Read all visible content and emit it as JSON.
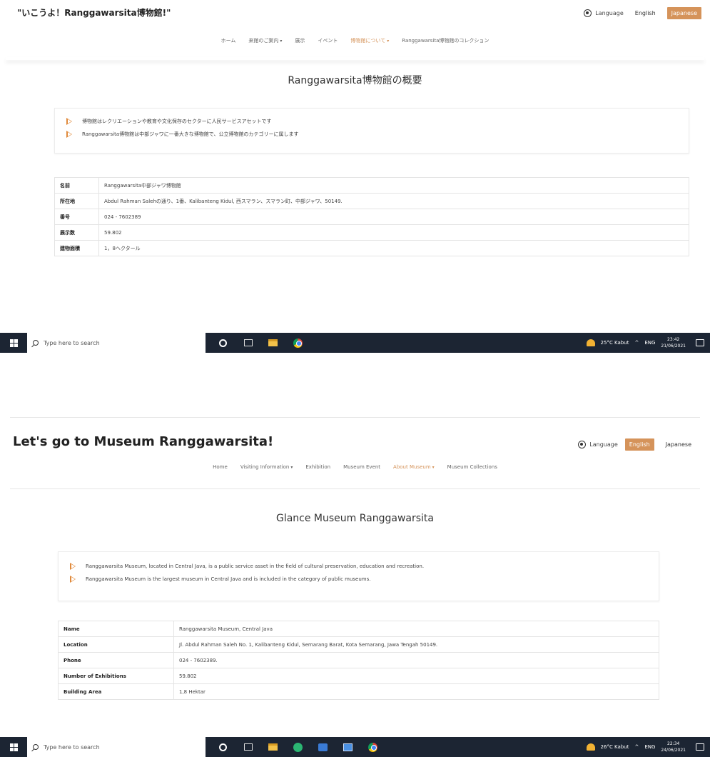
{
  "japanese_view": {
    "site_title": "\"いこうよ！Ranggawarsita博物館!\"",
    "language_label": "Language",
    "languages": {
      "english": "English",
      "japanese": "Japanese"
    },
    "active_language": "Japanese",
    "nav": [
      {
        "label": "ホーム",
        "has_caret": false,
        "active": false
      },
      {
        "label": "来館のご案内",
        "has_caret": true,
        "active": false
      },
      {
        "label": "展示",
        "has_caret": false,
        "active": false
      },
      {
        "label": "イベント",
        "has_caret": false,
        "active": false
      },
      {
        "label": "博物館について",
        "has_caret": true,
        "active": true
      },
      {
        "label": "Ranggawarsita博物館のコレクション",
        "has_caret": false,
        "active": false
      }
    ],
    "heading": "Ranggawarsita博物館の概要",
    "bullets": [
      "博物館はレクリエーションや教育や文化保存のセクターに人民サービスアセットです",
      "Ranggawarsita博物館は中部ジャワに一番大きな博物館で、公立博物館のカテゴリーに属します"
    ],
    "table": [
      {
        "label": "名前",
        "value": "Ranggawarsita中部ジャワ博物館"
      },
      {
        "label": "所在地",
        "value": "Abdul Rahman Salehの通り、1番、Kalibanteng Kidul, 西スマラン、スマラン町、中部ジャワ、50149."
      },
      {
        "label": "番号",
        "value": "024 - 7602389"
      },
      {
        "label": "展示数",
        "value": "59.802"
      },
      {
        "label": "建物面積",
        "value": "1，8ヘクタール"
      }
    ],
    "taskbar": {
      "search_placeholder": "Type here to search",
      "weather": "25°C Kabut",
      "lang": "ENG",
      "time": "23:42",
      "date": "21/06/2021"
    }
  },
  "english_view": {
    "site_title": "Let's go to Museum Ranggawarsita!",
    "language_label": "Language",
    "languages": {
      "english": "English",
      "japanese": "Japanese"
    },
    "active_language": "English",
    "nav": [
      {
        "label": "Home",
        "has_caret": false,
        "active": false
      },
      {
        "label": "Visiting Information",
        "has_caret": true,
        "active": false
      },
      {
        "label": "Exhibition",
        "has_caret": false,
        "active": false
      },
      {
        "label": "Museum Event",
        "has_caret": false,
        "active": false
      },
      {
        "label": "About Museum",
        "has_caret": true,
        "active": true
      },
      {
        "label": "Museum Collections",
        "has_caret": false,
        "active": false
      }
    ],
    "heading": "Glance Museum Ranggawarsita",
    "bullets": [
      "Ranggawarsita Museum, located in Central Java, is a public service asset in the field of cultural preservation, education and recreation.",
      "Ranggawarsita Museum is the largest museum in Central Java and is included in the category of public museums."
    ],
    "table": [
      {
        "label": "Name",
        "value": "Ranggawarsita Museum, Central Java"
      },
      {
        "label": "Location",
        "value": "Jl. Abdul Rahman Saleh No. 1, Kalibanteng Kidul, Semarang Barat, Kota Semarang, Jawa Tengah 50149."
      },
      {
        "label": "Phone",
        "value": "024 - 7602389."
      },
      {
        "label": "Number of Exhibitions",
        "value": "59.802"
      },
      {
        "label": "Building Area",
        "value": "1,8 Hektar"
      }
    ],
    "taskbar": {
      "search_placeholder": "Type here to search",
      "weather": "26°C Kabut",
      "lang": "ENG",
      "time": "22:34",
      "date": "24/06/2021"
    }
  },
  "colors": {
    "accent": "#d5935a",
    "bullet_arrow": "#e08a3c",
    "taskbar": "#1c2533"
  },
  "icons": [
    "globe-icon",
    "windows-icon",
    "search-icon",
    "cortana-icon",
    "task-view-icon",
    "file-explorer-icon",
    "chrome-icon",
    "weather-icon",
    "notification-icon"
  ]
}
